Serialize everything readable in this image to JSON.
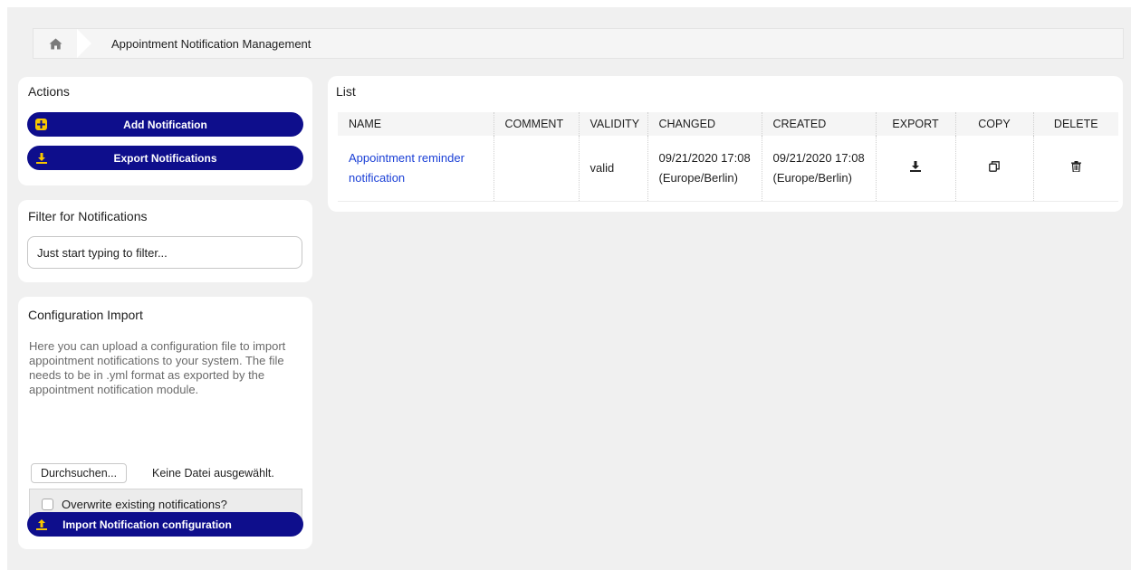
{
  "breadcrumb": {
    "home_icon": "home-icon",
    "title": "Appointment Notification Management"
  },
  "actions": {
    "title": "Actions",
    "add_label": "Add Notification",
    "export_label": "Export Notifications"
  },
  "filter": {
    "title": "Filter for Notifications",
    "placeholder": "Just start typing to filter..."
  },
  "import": {
    "title": "Configuration Import",
    "description": "Here you can upload a configuration file to import appointment notifications to your system. The file needs to be in .yml format as exported by the appointment notification module.",
    "browse_label": "Durchsuchen...",
    "file_status": "Keine Datei ausgewählt.",
    "overwrite_label": "Overwrite existing notifications?",
    "import_label": "Import Notification configuration"
  },
  "list": {
    "title": "List",
    "columns": [
      "NAME",
      "COMMENT",
      "VALIDITY",
      "CHANGED",
      "CREATED",
      "EXPORT",
      "COPY",
      "DELETE"
    ],
    "rows": [
      {
        "name": "Appointment reminder notification",
        "comment": "",
        "validity": "valid",
        "changed": "09/21/2020 17:08 (Europe/Berlin)",
        "created": "09/21/2020 17:08 (Europe/Berlin)",
        "export_icon": "download-icon",
        "copy_icon": "copy-icon",
        "delete_icon": "trash-icon"
      }
    ]
  },
  "colors": {
    "primary": "#0e0e8c",
    "accent": "#f7c600",
    "link": "#1a3fd6"
  }
}
